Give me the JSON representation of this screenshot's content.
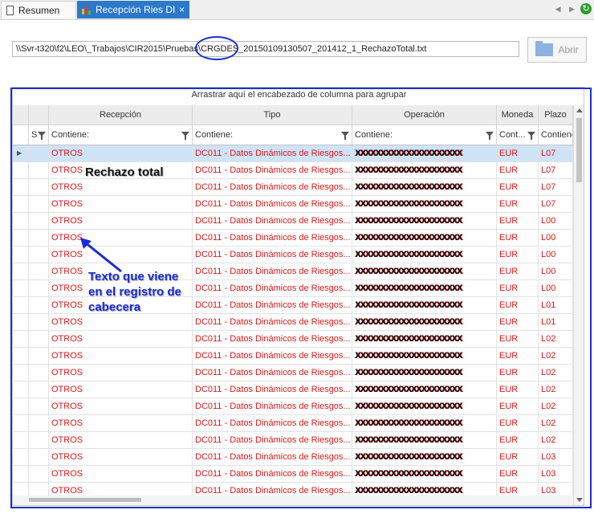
{
  "tabs": [
    {
      "label": "Resumen",
      "icon": "document-icon"
    },
    {
      "label": "Recepción Ries DI",
      "icon": "chart-icon",
      "close": "×"
    }
  ],
  "path": {
    "value": "\\\\Svr-t320\\f2\\LEO\\_Trabajos\\CIR2015\\Pruebas\\CRGDES_20150109130507_201412_1_RechazoTotal.txt"
  },
  "open_button": {
    "label": "Abrir",
    "icon": "folder-icon"
  },
  "grid": {
    "group_panel_text": "Arrastrar aquí el encabezado de columna para agrupar",
    "columns": [
      {
        "header": "",
        "filter": "S"
      },
      {
        "header": "Recepción",
        "filter": "Contiene:"
      },
      {
        "header": "Tipo",
        "filter": "Contiene:"
      },
      {
        "header": "Operación",
        "filter": "Contiene:"
      },
      {
        "header": "Moneda",
        "filter": "Cont..."
      },
      {
        "header": "Plazo",
        "filter": "Contiene"
      }
    ],
    "rows": [
      {
        "recepcion": "OTROS",
        "tipo": "DC011 - Datos Dinámicos de Riesgos...",
        "operacion": "XXXXXXXXXXXXXXXXXXXXX",
        "moneda": "EUR",
        "plazo": "L07"
      },
      {
        "recepcion": "OTROS",
        "tipo": "DC011 - Datos Dinámicos de Riesgos...",
        "operacion": "XXXXXXXXXXXXXXXXXXXXX",
        "moneda": "EUR",
        "plazo": "L07"
      },
      {
        "recepcion": "OTROS",
        "tipo": "DC011 - Datos Dinámicos de Riesgos...",
        "operacion": "XXXXXXXXXXXXXXXXXXXXX",
        "moneda": "EUR",
        "plazo": "L07"
      },
      {
        "recepcion": "OTROS",
        "tipo": "DC011 - Datos Dinámicos de Riesgos...",
        "operacion": "XXXXXXXXXXXXXXXXXXXXX",
        "moneda": "EUR",
        "plazo": "L07"
      },
      {
        "recepcion": "OTROS",
        "tipo": "DC011 - Datos Dinámicos de Riesgos...",
        "operacion": "XXXXXXXXXXXXXXXXXXXXX",
        "moneda": "EUR",
        "plazo": "L00"
      },
      {
        "recepcion": "OTROS",
        "tipo": "DC011 - Datos Dinámicos de Riesgos...",
        "operacion": "XXXXXXXXXXXXXXXXXXXXX",
        "moneda": "EUR",
        "plazo": "L00"
      },
      {
        "recepcion": "OTROS",
        "tipo": "DC011 - Datos Dinámicos de Riesgos...",
        "operacion": "XXXXXXXXXXXXXXXXXXXXX",
        "moneda": "EUR",
        "plazo": "L00"
      },
      {
        "recepcion": "OTROS",
        "tipo": "DC011 - Datos Dinámicos de Riesgos...",
        "operacion": "XXXXXXXXXXXXXXXXXXXXX",
        "moneda": "EUR",
        "plazo": "L00"
      },
      {
        "recepcion": "OTROS",
        "tipo": "DC011 - Datos Dinámicos de Riesgos...",
        "operacion": "XXXXXXXXXXXXXXXXXXXXX",
        "moneda": "EUR",
        "plazo": "L00"
      },
      {
        "recepcion": "OTROS",
        "tipo": "DC011 - Datos Dinámicos de Riesgos...",
        "operacion": "XXXXXXXXXXXXXXXXXXXXX",
        "moneda": "EUR",
        "plazo": "L01"
      },
      {
        "recepcion": "OTROS",
        "tipo": "DC011 - Datos Dinámicos de Riesgos...",
        "operacion": "XXXXXXXXXXXXXXXXXXXXX",
        "moneda": "EUR",
        "plazo": "L01"
      },
      {
        "recepcion": "OTROS",
        "tipo": "DC011 - Datos Dinámicos de Riesgos...",
        "operacion": "XXXXXXXXXXXXXXXXXXXXX",
        "moneda": "EUR",
        "plazo": "L02"
      },
      {
        "recepcion": "OTROS",
        "tipo": "DC011 - Datos Dinámicos de Riesgos...",
        "operacion": "XXXXXXXXXXXXXXXXXXXXX",
        "moneda": "EUR",
        "plazo": "L02"
      },
      {
        "recepcion": "OTROS",
        "tipo": "DC011 - Datos Dinámicos de Riesgos...",
        "operacion": "XXXXXXXXXXXXXXXXXXXXX",
        "moneda": "EUR",
        "plazo": "L02"
      },
      {
        "recepcion": "OTROS",
        "tipo": "DC011 - Datos Dinámicos de Riesgos...",
        "operacion": "XXXXXXXXXXXXXXXXXXXXX",
        "moneda": "EUR",
        "plazo": "L02"
      },
      {
        "recepcion": "OTROS",
        "tipo": "DC011 - Datos Dinámicos de Riesgos...",
        "operacion": "XXXXXXXXXXXXXXXXXXXXX",
        "moneda": "EUR",
        "plazo": "L02"
      },
      {
        "recepcion": "OTROS",
        "tipo": "DC011 - Datos Dinámicos de Riesgos...",
        "operacion": "XXXXXXXXXXXXXXXXXXXXX",
        "moneda": "EUR",
        "plazo": "L02"
      },
      {
        "recepcion": "OTROS",
        "tipo": "DC011 - Datos Dinámicos de Riesgos...",
        "operacion": "XXXXXXXXXXXXXXXXXXXXX",
        "moneda": "EUR",
        "plazo": "L02"
      },
      {
        "recepcion": "OTROS",
        "tipo": "DC011 - Datos Dinámicos de Riesgos...",
        "operacion": "XXXXXXXXXXXXXXXXXXXXX",
        "moneda": "EUR",
        "plazo": "L03"
      },
      {
        "recepcion": "OTROS",
        "tipo": "DC011 - Datos Dinámicos de Riesgos...",
        "operacion": "XXXXXXXXXXXXXXXXXXXXX",
        "moneda": "EUR",
        "plazo": "L03"
      },
      {
        "recepcion": "OTROS",
        "tipo": "DC011 - Datos Dinámicos de Riesgos...",
        "operacion": "XXXXXXXXXXXXXXXXXXXXX",
        "moneda": "EUR",
        "plazo": "L03"
      }
    ]
  },
  "annotations": {
    "rechazo": "Rechazo total",
    "texto_lines": [
      "Texto que viene",
      "en el registro de",
      "cabecera"
    ]
  },
  "colors": {
    "accent": "#2b78cc",
    "row_text": "#e01818",
    "annotation": "#1a2bd6"
  }
}
